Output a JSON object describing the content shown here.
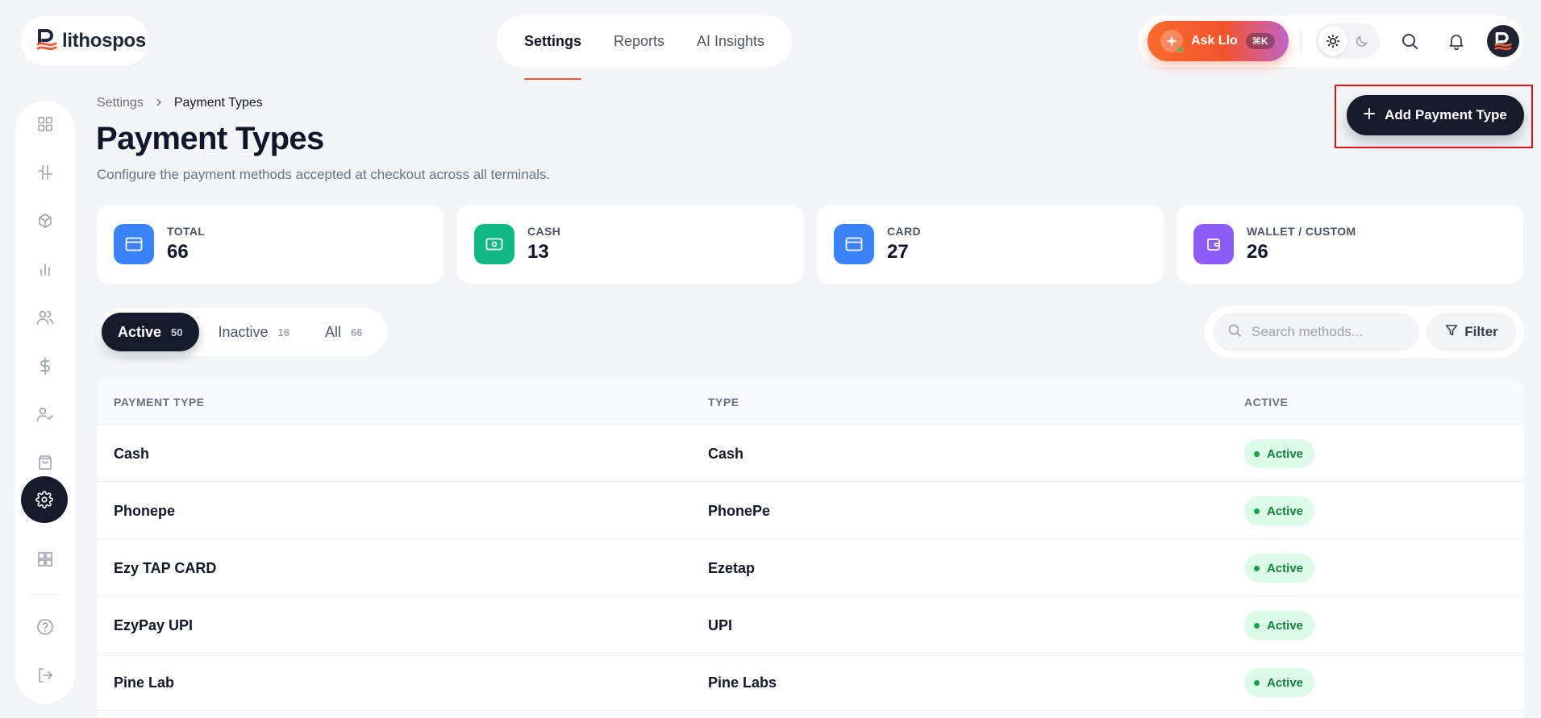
{
  "brand": {
    "name": "lithospos",
    "accent": "#f05a3a"
  },
  "topnav": {
    "tabs": [
      {
        "label": "Settings",
        "active": true
      },
      {
        "label": "Reports",
        "active": false
      },
      {
        "label": "AI Insights",
        "active": false
      }
    ]
  },
  "assistant": {
    "label": "Ask Llo",
    "shortcut": "⌘K"
  },
  "theme": {
    "selected": "light"
  },
  "sidebar": {
    "items": [
      {
        "icon": "dashboard-grid-icon"
      },
      {
        "icon": "adjustments-icon"
      },
      {
        "icon": "box-icon"
      },
      {
        "icon": "bar-chart-icon"
      },
      {
        "icon": "users-icon"
      },
      {
        "icon": "dollar-icon"
      },
      {
        "icon": "user-check-icon"
      },
      {
        "icon": "shopping-bag-icon"
      },
      {
        "icon": "gear-icon",
        "active": true
      },
      {
        "icon": "apps-grid-icon"
      },
      {
        "icon": "help-icon"
      },
      {
        "icon": "logout-icon"
      }
    ]
  },
  "breadcrumb": {
    "parent": "Settings",
    "current": "Payment Types"
  },
  "page": {
    "title": "Payment Types",
    "subtitle": "Configure the payment methods accepted at checkout across all terminals.",
    "add_button": "Add Payment Type"
  },
  "stats": [
    {
      "label": "TOTAL",
      "value": "66",
      "color": "#3b82f6",
      "icon": "card-icon"
    },
    {
      "label": "CASH",
      "value": "13",
      "color": "#10b981",
      "icon": "banknote-icon"
    },
    {
      "label": "CARD",
      "value": "27",
      "color": "#3b82f6",
      "icon": "card-icon"
    },
    {
      "label": "WALLET / CUSTOM",
      "value": "26",
      "color": "#8b5cf6",
      "icon": "wallet-icon"
    }
  ],
  "tabs": [
    {
      "label": "Active",
      "count": "50",
      "active": true
    },
    {
      "label": "Inactive",
      "count": "16",
      "active": false
    },
    {
      "label": "All",
      "count": "66",
      "active": false
    }
  ],
  "search": {
    "placeholder": "Search methods...",
    "value": ""
  },
  "filter": {
    "label": "Filter"
  },
  "table": {
    "headers": [
      "PAYMENT TYPE",
      "TYPE",
      "ACTIVE"
    ],
    "rows": [
      {
        "name": "Cash",
        "type": "Cash",
        "status": "Active"
      },
      {
        "name": "Phonepe",
        "type": "PhonePe",
        "status": "Active"
      },
      {
        "name": "Ezy TAP CARD",
        "type": "Ezetap",
        "status": "Active"
      },
      {
        "name": "EzyPay UPI",
        "type": "UPI",
        "status": "Active"
      },
      {
        "name": "Pine Lab",
        "type": "Pine Labs",
        "status": "Active"
      }
    ]
  }
}
